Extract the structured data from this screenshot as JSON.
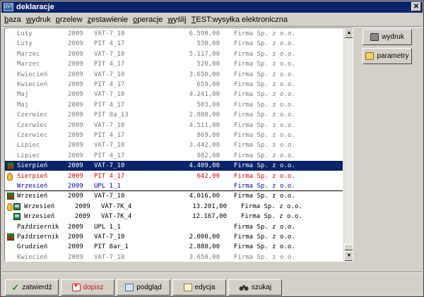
{
  "window": {
    "title": "deklaracje",
    "app_icon_text": "UVT"
  },
  "menu": [
    "baza",
    "wydruk",
    "przelew",
    "zestawienie",
    "operacje",
    "wyślij",
    "TEST:wysyłka elektroniczna"
  ],
  "rows": [
    {
      "month": "Luty",
      "year": "2009",
      "form": "VAT-7_10",
      "amount": "6.590,00",
      "firm": "Firma Sp. z o.o.",
      "color": "#7a7a7a",
      "icons": []
    },
    {
      "month": "Luty",
      "year": "2009",
      "form": "PIT 4_17",
      "amount": "530,00",
      "firm": "Firma Sp. z o.o.",
      "color": "#7a7a7a",
      "icons": []
    },
    {
      "month": "Marzec",
      "year": "2009",
      "form": "VAT-7_10",
      "amount": "5.117,00",
      "firm": "Firma Sp. z o.o.",
      "color": "#7a7a7a",
      "icons": []
    },
    {
      "month": "Marzec",
      "year": "2009",
      "form": "PIT 4_17",
      "amount": "520,00",
      "firm": "Firma Sp. z o.o.",
      "color": "#7a7a7a",
      "icons": []
    },
    {
      "month": "Kwiecień",
      "year": "2009",
      "form": "VAT-7_10",
      "amount": "3.650,00",
      "firm": "Firma Sp. z o.o.",
      "color": "#7a7a7a",
      "icons": []
    },
    {
      "month": "Kwiecień",
      "year": "2009",
      "form": "PIT 4_17",
      "amount": "659,00",
      "firm": "Firma Sp. z o.o.",
      "color": "#7a7a7a",
      "icons": []
    },
    {
      "month": "Maj",
      "year": "2009",
      "form": "VAT-7_10",
      "amount": "4.241,00",
      "firm": "Firma Sp. z o.o.",
      "color": "#7a7a7a",
      "icons": []
    },
    {
      "month": "Maj",
      "year": "2009",
      "form": "PIT 4_17",
      "amount": "503,00",
      "firm": "Firma Sp. z o.o.",
      "color": "#7a7a7a",
      "icons": []
    },
    {
      "month": "Czerwiec",
      "year": "2009",
      "form": "PIT 8a_13",
      "amount": "2.880,00",
      "firm": "Firma Sp. z o.o.",
      "color": "#7a7a7a",
      "icons": []
    },
    {
      "month": "Czerwiec",
      "year": "2009",
      "form": "VAT-7_10",
      "amount": "4.511,00",
      "firm": "Firma Sp. z o.o.",
      "color": "#7a7a7a",
      "icons": []
    },
    {
      "month": "Czerwiec",
      "year": "2009",
      "form": "PIT 4_17",
      "amount": "869,00",
      "firm": "Firma Sp. z o.o.",
      "color": "#7a7a7a",
      "icons": []
    },
    {
      "month": "Lipiec",
      "year": "2009",
      "form": "VAT-7_10",
      "amount": "3.442,00",
      "firm": "Firma Sp. z o.o.",
      "color": "#7a7a7a",
      "icons": []
    },
    {
      "month": "Lipiec",
      "year": "2009",
      "form": "PIT 4_17",
      "amount": "982,00",
      "firm": "Firma Sp. z o.o.",
      "color": "#7a7a7a",
      "icons": []
    },
    {
      "month": "Sierpień",
      "year": "2009",
      "form": "VAT-7_10",
      "amount": "4.409,00",
      "firm": "Firma Sp. z o.o.",
      "color": "#ffffff",
      "selected": true,
      "icons": [
        "plant"
      ]
    },
    {
      "month": "Sierpień",
      "year": "2009",
      "form": "PIT 4_17",
      "amount": "642,00",
      "firm": "Firma Sp. z o.o.",
      "color": "#e00000",
      "icons": [
        "bulb"
      ]
    },
    {
      "month": "Wrzesień",
      "year": "2009",
      "form": "UPL 1_1",
      "amount": "",
      "firm": "Firma Sp. z o.o.",
      "color": "#0000d0",
      "icons": []
    },
    {
      "month": "Wrzesień",
      "year": "2009",
      "form": "VAT-7_10",
      "amount": "4.016,00",
      "firm": "Firma Sp. z o.o.",
      "color": "#000000",
      "icons": [
        "plant"
      ]
    },
    {
      "month": "Wrzesień",
      "year": "2009",
      "form": "VAT-7K_4",
      "amount": "13.201,00",
      "firm": "Firma Sp. z o.o.",
      "color": "#000000",
      "icons": [
        "bulb",
        "monitor"
      ]
    },
    {
      "month": "Wrzesień",
      "year": "2009",
      "form": "VAT-7K_4",
      "amount": "12.167,00",
      "firm": "Firma Sp. z o.o.",
      "color": "#000000",
      "icons": [
        "monitor"
      ]
    },
    {
      "month": "Październik",
      "year": "2009",
      "form": "UPL 1_1",
      "amount": "",
      "firm": "Firma Sp. z o.o.",
      "color": "#000000",
      "icons": []
    },
    {
      "month": "Październik",
      "year": "2009",
      "form": "VAT-7_10",
      "amount": "2.000,00",
      "firm": "Firma Sp. z o.o.",
      "color": "#000000",
      "icons": [
        "plant"
      ]
    },
    {
      "month": "Grudzień",
      "year": "2009",
      "form": "PIT 8ar_1",
      "amount": "2.880,00",
      "firm": "Firma Sp. z o.o.",
      "color": "#000000",
      "icons": []
    },
    {
      "month": "Kwiecień",
      "year": "2009",
      "form": "VAT-7_10",
      "amount": "3.650,00",
      "firm": "Firma Sp. z o.o.",
      "color": "#7a7a7a",
      "icons": []
    }
  ],
  "right_buttons": {
    "print": "wydruk",
    "params": "parametry"
  },
  "bottom_buttons": {
    "approve": "zatwierdź",
    "add": "dopisz",
    "preview": "podgląd",
    "edit": "edycja",
    "search": "szukaj"
  },
  "colors": {
    "title_bar": "#0a246a",
    "selection": "#0a246a",
    "face": "#d4d0c8"
  }
}
